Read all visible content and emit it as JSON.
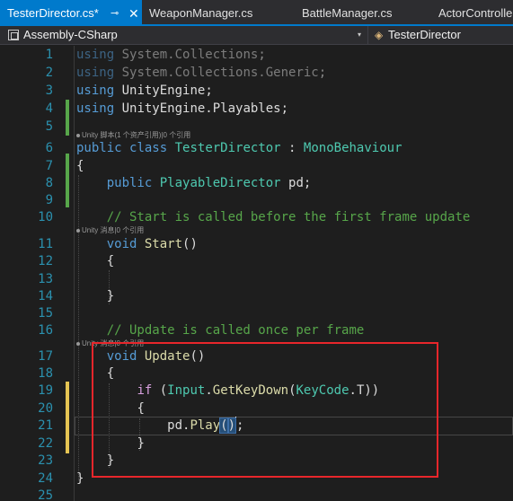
{
  "tabs": [
    {
      "label": "TesterDirector.cs*",
      "active": true,
      "pin_glyph": "⊸",
      "close_glyph": "✕"
    },
    {
      "label": "WeaponManager.cs"
    },
    {
      "label": "BattleManager.cs"
    },
    {
      "label": "ActorControlle"
    }
  ],
  "navbar": {
    "project": "Assembly-CSharp",
    "class_name": "TesterDirector",
    "dropdown_glyph": "▾",
    "class_icon": "◈"
  },
  "line_numbers": [
    "1",
    "2",
    "3",
    "4",
    "5",
    "6",
    "7",
    "8",
    "9",
    "10",
    "11",
    "12",
    "13",
    "14",
    "15",
    "16",
    "17",
    "18",
    "19",
    "20",
    "21",
    "22",
    "23",
    "24",
    "25"
  ],
  "code": {
    "l1": {
      "kw": "using",
      "ns": "System.Collections",
      "end": ";"
    },
    "l2": {
      "kw": "using",
      "ns": "System.Collections.Generic",
      "end": ";"
    },
    "l3": {
      "kw": "using",
      "ns": "UnityEngine",
      "end": ";"
    },
    "l4": {
      "kw": "using",
      "ns": "UnityEngine.Playables",
      "end": ";"
    },
    "lens1": "Unity 脚本(1 个资产引用)|0 个引用",
    "l6": {
      "kw1": "public",
      "kw2": "class",
      "name": "TesterDirector",
      "colon": " : ",
      "base": "MonoBehaviour"
    },
    "l7": "{",
    "l8": {
      "kw": "public",
      "type": "PlayableDirector",
      "field": "pd",
      "end": ";"
    },
    "l10": "// Start is called before the first frame update",
    "lens2": "Unity 消息|0 个引用",
    "l11": {
      "kw": "void",
      "name": "Start",
      "parens": "()"
    },
    "l12": "{",
    "l14": "}",
    "l16": "// Update is called once per frame",
    "lens3": "Unity 消息|0 个引用",
    "l17": {
      "kw": "void",
      "name": "Update",
      "parens": "()"
    },
    "l18": "{",
    "l19": {
      "kw": "if",
      "open": "(",
      "type": "Input",
      "dot": ".",
      "method": "GetKeyDown",
      "paren": "(",
      "enum": "KeyCode",
      "member": ".T",
      "close": "))"
    },
    "l20": "{",
    "l21": {
      "obj": "pd",
      "dot": ".",
      "method": "Play",
      "open": "(",
      "close": ")",
      "end": ";"
    },
    "l22": "}",
    "l23": "}",
    "l24": "}"
  },
  "colors": {
    "accent": "#007acc",
    "annotation_box": "#e8262b",
    "keyword": "#569cd6",
    "type": "#4ec9b0",
    "method": "#dcdcaa",
    "comment": "#57a64a",
    "line_number": "#2b91af"
  }
}
